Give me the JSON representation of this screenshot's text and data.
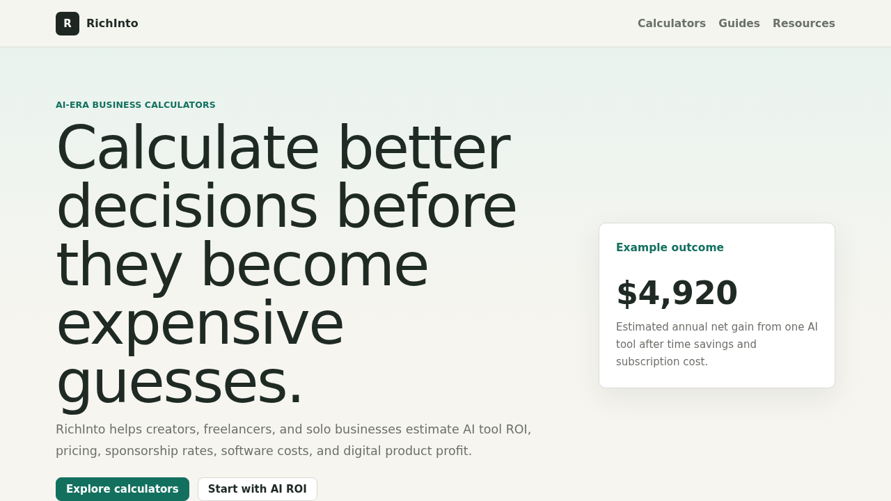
{
  "header": {
    "logo": {
      "mark": "R",
      "name": "RichInto"
    },
    "nav": [
      "Calculators",
      "Guides",
      "Resources"
    ]
  },
  "hero": {
    "eyebrow": "AI-ERA BUSINESS CALCULATORS",
    "headline": "Calculate better decisions before they become expensive guesses.",
    "description": "RichInto helps creators, freelancers, and solo businesses estimate AI tool ROI, pricing, sponsorship rates, software costs, and digital product profit.",
    "buttons": [
      {
        "label": "Explore calculators",
        "kind": "primary"
      },
      {
        "label": "Start with AI ROI",
        "kind": "secondary"
      }
    ]
  },
  "card": {
    "label": "Example outcome",
    "value": "$4,920",
    "description": "Estimated annual net gain from one AI tool after time savings and subscription cost."
  }
}
